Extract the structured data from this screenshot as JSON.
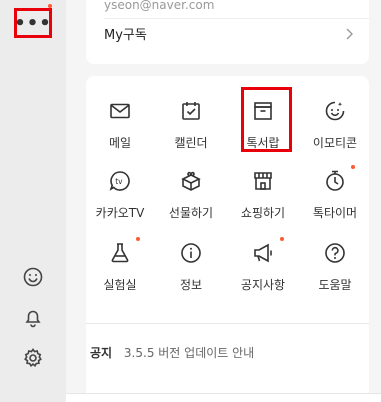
{
  "sidebar": {
    "more_label": "•••",
    "icons": [
      "emoji-icon",
      "bell-icon",
      "gear-icon"
    ]
  },
  "account": {
    "email": "yseon@naver.com",
    "my_subscription": "My구독"
  },
  "grid": {
    "items": [
      {
        "label": "메일",
        "icon": "mail-icon"
      },
      {
        "label": "캘린더",
        "icon": "calendar-icon"
      },
      {
        "label": "톡서랍",
        "icon": "drawer-icon"
      },
      {
        "label": "이모티콘",
        "icon": "emoticon-icon"
      },
      {
        "label": "카카오TV",
        "icon": "tv-icon"
      },
      {
        "label": "선물하기",
        "icon": "gift-icon"
      },
      {
        "label": "쇼핑하기",
        "icon": "shop-icon"
      },
      {
        "label": "톡타이머",
        "icon": "timer-icon"
      },
      {
        "label": "실험실",
        "icon": "lab-icon"
      },
      {
        "label": "정보",
        "icon": "info-icon"
      },
      {
        "label": "공지사항",
        "icon": "megaphone-icon"
      },
      {
        "label": "도움말",
        "icon": "help-icon"
      }
    ]
  },
  "notice": {
    "title": "공지",
    "text": "3.5.5 버전 업데이트 안내"
  },
  "colors": {
    "highlight": "#e8000b",
    "badge": "#ff5a36"
  }
}
